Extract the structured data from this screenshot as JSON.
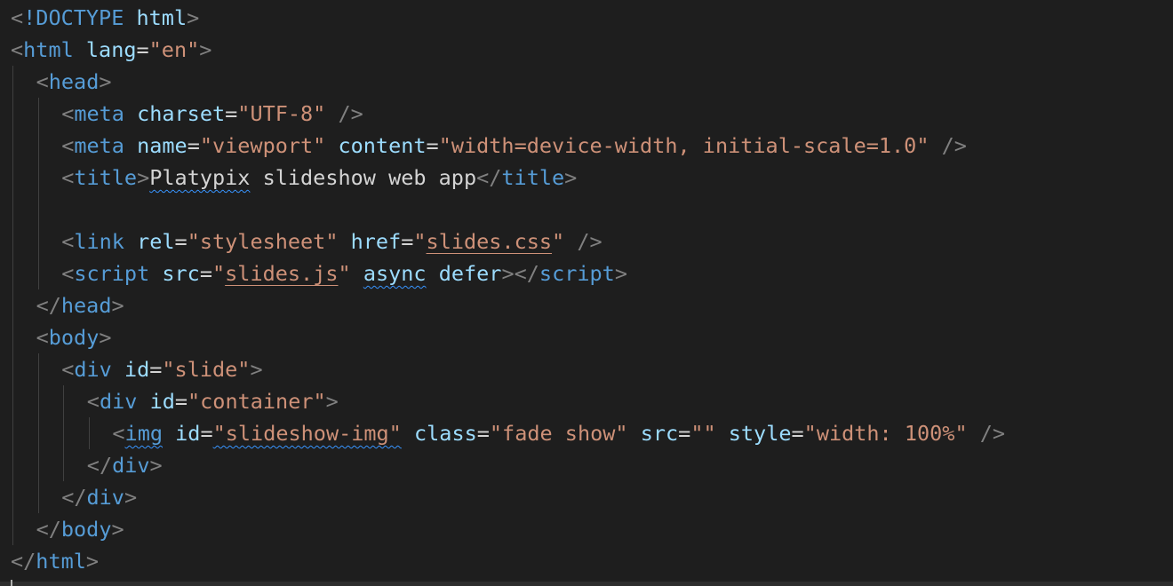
{
  "editor": {
    "lines": [
      {
        "indent": 0,
        "tokens": [
          {
            "t": "<",
            "c": "p"
          },
          {
            "t": "!DOCTYPE",
            "c": "t"
          },
          {
            "t": " ",
            "c": "x"
          },
          {
            "t": "html",
            "c": "a"
          },
          {
            "t": ">",
            "c": "p"
          }
        ]
      },
      {
        "indent": 0,
        "tokens": [
          {
            "t": "<",
            "c": "p"
          },
          {
            "t": "html",
            "c": "t"
          },
          {
            "t": " ",
            "c": "x"
          },
          {
            "t": "lang",
            "c": "a"
          },
          {
            "t": "=",
            "c": "x"
          },
          {
            "t": "\"en\"",
            "c": "s"
          },
          {
            "t": ">",
            "c": "p"
          }
        ]
      },
      {
        "indent": 1,
        "tokens": [
          {
            "t": "<",
            "c": "p"
          },
          {
            "t": "head",
            "c": "t"
          },
          {
            "t": ">",
            "c": "p"
          }
        ]
      },
      {
        "indent": 2,
        "tokens": [
          {
            "t": "<",
            "c": "p"
          },
          {
            "t": "meta",
            "c": "t"
          },
          {
            "t": " ",
            "c": "x"
          },
          {
            "t": "charset",
            "c": "a"
          },
          {
            "t": "=",
            "c": "x"
          },
          {
            "t": "\"UTF-8\"",
            "c": "s"
          },
          {
            "t": " ",
            "c": "x"
          },
          {
            "t": "/>",
            "c": "p"
          }
        ]
      },
      {
        "indent": 2,
        "tokens": [
          {
            "t": "<",
            "c": "p"
          },
          {
            "t": "meta",
            "c": "t"
          },
          {
            "t": " ",
            "c": "x"
          },
          {
            "t": "name",
            "c": "a"
          },
          {
            "t": "=",
            "c": "x"
          },
          {
            "t": "\"viewport\"",
            "c": "s"
          },
          {
            "t": " ",
            "c": "x"
          },
          {
            "t": "content",
            "c": "a"
          },
          {
            "t": "=",
            "c": "x"
          },
          {
            "t": "\"width=device-width, initial-scale=1.0\"",
            "c": "s"
          },
          {
            "t": " ",
            "c": "x"
          },
          {
            "t": "/>",
            "c": "p"
          }
        ]
      },
      {
        "indent": 2,
        "tokens": [
          {
            "t": "<",
            "c": "p"
          },
          {
            "t": "title",
            "c": "t"
          },
          {
            "t": ">",
            "c": "p"
          },
          {
            "t": "Platypix",
            "c": "x",
            "deco": "sq"
          },
          {
            "t": " slideshow web app",
            "c": "x"
          },
          {
            "t": "</",
            "c": "p"
          },
          {
            "t": "title",
            "c": "t"
          },
          {
            "t": ">",
            "c": "p"
          }
        ]
      },
      {
        "indent": 0,
        "tokens": []
      },
      {
        "indent": 2,
        "tokens": [
          {
            "t": "<",
            "c": "p"
          },
          {
            "t": "link",
            "c": "t"
          },
          {
            "t": " ",
            "c": "x"
          },
          {
            "t": "rel",
            "c": "a"
          },
          {
            "t": "=",
            "c": "x"
          },
          {
            "t": "\"stylesheet\"",
            "c": "s"
          },
          {
            "t": " ",
            "c": "x"
          },
          {
            "t": "href",
            "c": "a"
          },
          {
            "t": "=",
            "c": "x"
          },
          {
            "t": "\"",
            "c": "s"
          },
          {
            "t": "slides.css",
            "c": "s",
            "deco": "ul"
          },
          {
            "t": "\"",
            "c": "s"
          },
          {
            "t": " ",
            "c": "x"
          },
          {
            "t": "/>",
            "c": "p"
          }
        ]
      },
      {
        "indent": 2,
        "tokens": [
          {
            "t": "<",
            "c": "p"
          },
          {
            "t": "script",
            "c": "t"
          },
          {
            "t": " ",
            "c": "x"
          },
          {
            "t": "src",
            "c": "a"
          },
          {
            "t": "=",
            "c": "x"
          },
          {
            "t": "\"",
            "c": "s"
          },
          {
            "t": "slides.js",
            "c": "s",
            "deco": "ul"
          },
          {
            "t": "\"",
            "c": "s"
          },
          {
            "t": " ",
            "c": "x"
          },
          {
            "t": "async",
            "c": "a",
            "deco": "sq"
          },
          {
            "t": " ",
            "c": "x"
          },
          {
            "t": "defer",
            "c": "a"
          },
          {
            "t": "></",
            "c": "p"
          },
          {
            "t": "script",
            "c": "t"
          },
          {
            "t": ">",
            "c": "p"
          }
        ]
      },
      {
        "indent": 1,
        "tokens": [
          {
            "t": "</",
            "c": "p"
          },
          {
            "t": "head",
            "c": "t"
          },
          {
            "t": ">",
            "c": "p"
          }
        ]
      },
      {
        "indent": 1,
        "tokens": [
          {
            "t": "<",
            "c": "p"
          },
          {
            "t": "body",
            "c": "t"
          },
          {
            "t": ">",
            "c": "p"
          }
        ]
      },
      {
        "indent": 2,
        "tokens": [
          {
            "t": "<",
            "c": "p"
          },
          {
            "t": "div",
            "c": "t"
          },
          {
            "t": " ",
            "c": "x"
          },
          {
            "t": "id",
            "c": "a"
          },
          {
            "t": "=",
            "c": "x"
          },
          {
            "t": "\"slide\"",
            "c": "s"
          },
          {
            "t": ">",
            "c": "p"
          }
        ]
      },
      {
        "indent": 3,
        "tokens": [
          {
            "t": "<",
            "c": "p"
          },
          {
            "t": "div",
            "c": "t"
          },
          {
            "t": " ",
            "c": "x"
          },
          {
            "t": "id",
            "c": "a"
          },
          {
            "t": "=",
            "c": "x"
          },
          {
            "t": "\"container\"",
            "c": "s"
          },
          {
            "t": ">",
            "c": "p"
          }
        ]
      },
      {
        "indent": 4,
        "tokens": [
          {
            "t": "<",
            "c": "p"
          },
          {
            "t": "img",
            "c": "t",
            "deco": "sq"
          },
          {
            "t": " ",
            "c": "x"
          },
          {
            "t": "id",
            "c": "a"
          },
          {
            "t": "=",
            "c": "x"
          },
          {
            "t": "\"slideshow-img\"",
            "c": "s",
            "deco": "sq"
          },
          {
            "t": " ",
            "c": "x"
          },
          {
            "t": "class",
            "c": "a"
          },
          {
            "t": "=",
            "c": "x"
          },
          {
            "t": "\"fade show\"",
            "c": "s"
          },
          {
            "t": " ",
            "c": "x"
          },
          {
            "t": "src",
            "c": "a"
          },
          {
            "t": "=",
            "c": "x"
          },
          {
            "t": "\"\"",
            "c": "s"
          },
          {
            "t": " ",
            "c": "x"
          },
          {
            "t": "style",
            "c": "a"
          },
          {
            "t": "=",
            "c": "x"
          },
          {
            "t": "\"width: 100%\"",
            "c": "s"
          },
          {
            "t": " ",
            "c": "x"
          },
          {
            "t": "/>",
            "c": "p"
          }
        ]
      },
      {
        "indent": 3,
        "tokens": [
          {
            "t": "</",
            "c": "p"
          },
          {
            "t": "div",
            "c": "t"
          },
          {
            "t": ">",
            "c": "p"
          }
        ]
      },
      {
        "indent": 2,
        "tokens": [
          {
            "t": "</",
            "c": "p"
          },
          {
            "t": "div",
            "c": "t"
          },
          {
            "t": ">",
            "c": "p"
          }
        ]
      },
      {
        "indent": 1,
        "tokens": [
          {
            "t": "</",
            "c": "p"
          },
          {
            "t": "body",
            "c": "t"
          },
          {
            "t": ">",
            "c": "p"
          }
        ]
      },
      {
        "indent": 0,
        "tokens": [
          {
            "t": "</",
            "c": "p"
          },
          {
            "t": "html",
            "c": "t"
          },
          {
            "t": ">",
            "c": "p"
          }
        ]
      }
    ]
  },
  "colors": {
    "background": "#1e1e1e",
    "punctuation": "#808080",
    "tag": "#569cd6",
    "attribute": "#9cdcfe",
    "string": "#ce9178",
    "text": "#d4d4d4",
    "squiggle": "#3794ff"
  }
}
